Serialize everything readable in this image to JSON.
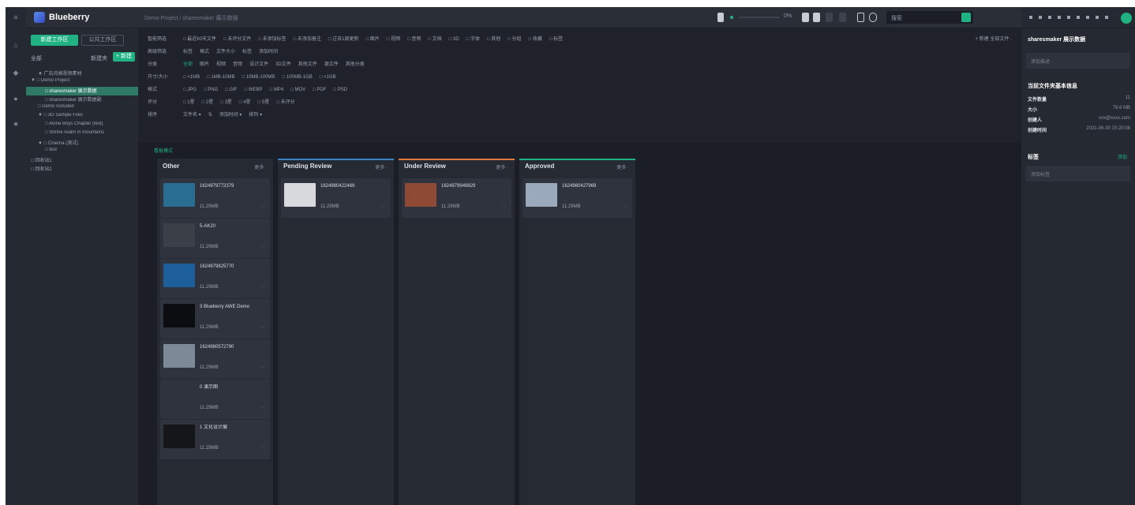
{
  "app": {
    "brand": "Blueberry",
    "breadcrumb": "Demo Project  /  sharesmaker 展示数据"
  },
  "rail": {
    "icons": [
      "menu-icon",
      "home-icon",
      "bell-icon",
      "user-icon",
      "star-icon"
    ]
  },
  "topbar": {
    "search_placeholder": "搜索",
    "zoom": "0%"
  },
  "sidebar": {
    "new_button": "新建工作区",
    "workspace_button": "公共工作区",
    "all_label": "全部",
    "add_folder": "新建夹",
    "new_tag": "+ 新建",
    "tree": [
      {
        "label": "▼ 广告风格视频素材",
        "indent": 1,
        "selected": false
      },
      {
        "label": "▼ □ Demo Project",
        "indent": 0,
        "selected": false
      },
      {
        "label": "□ sharesmaker 展示数据",
        "indent": 2,
        "selected": true
      },
      {
        "label": "□ sharesmaker 展示数据副",
        "indent": 2,
        "selected": false
      },
      {
        "label": "□ Demo Included",
        "indent": 1,
        "selected": false
      },
      {
        "label": "▼ □ 3D Sample Files",
        "indent": 1,
        "selected": false
      },
      {
        "label": "□ Alone Boys Chapter (test)",
        "indent": 2,
        "selected": false
      },
      {
        "label": "□ Shrine realm in mountains",
        "indent": 2,
        "selected": false
      },
      {
        "label": "▼ □ Cinema (测试)",
        "indent": 1,
        "selected": false
      },
      {
        "label": "□ test",
        "indent": 2,
        "selected": false
      },
      {
        "label": "□ 回收站1",
        "indent": 0,
        "selected": false
      },
      {
        "label": "□ 回收站2",
        "indent": 0,
        "selected": false
      }
    ]
  },
  "filters": {
    "right_label": "+ 新建  全部文件 ·",
    "rows": [
      {
        "label": "智能筛选",
        "chips": [
          "□ 最近60天文件",
          "□ 未评分文件",
          "□ 未添加标签",
          "□ 未添加备注",
          "□ 过去1周更新",
          "□ 图片",
          "□ 视频",
          "□ 音频",
          "□ 文档",
          "□ 3D",
          "□ 字体",
          "□ 其他",
          "□ 分组",
          "□ 收藏",
          "□ 标签"
        ]
      },
      {
        "label": "高级筛选",
        "chips": [
          "标签",
          "格式",
          "文件大小",
          "标签",
          "添加时间"
        ]
      },
      {
        "label": "分类",
        "chips": [
          "全部",
          "图片",
          "视频",
          "音频",
          "设计文件",
          "3D文件",
          "其他文件",
          "源文件",
          "其他分类"
        ]
      },
      {
        "label": "尺寸/大小",
        "chips": [
          "□ <1MB",
          "□ 1MB-10MB",
          "□ 10MB-100MB",
          "□ 100MB-1GB",
          "□ >1GB"
        ]
      },
      {
        "label": "格式",
        "chips": [
          "□ JPG",
          "□ PNG",
          "□ GIF",
          "□ WEBP",
          "□ MP4",
          "□ MOV",
          "□ PDF",
          "□ PSD"
        ]
      },
      {
        "label": "评分",
        "chips": [
          "□ 1星",
          "□ 2星",
          "□ 3星",
          "□ 4星",
          "□ 5星",
          "□ 未评分"
        ]
      },
      {
        "label": "排序",
        "chips": [
          "文件名 ▾",
          "⇅",
          "添加时间 ▾",
          "排列 ▾"
        ]
      }
    ]
  },
  "board": {
    "title": "看板模式",
    "columns": [
      {
        "name": "Other",
        "more": "更多 ·",
        "color": "#262a33",
        "cards": [
          {
            "title": "1624979772379",
            "size": "11.29MB",
            "thumb": "#2a6d92"
          },
          {
            "title": "5-AK20",
            "size": "11.29MB",
            "thumb": "#3a3f48"
          },
          {
            "title": "1624979825770",
            "size": "11.29MB",
            "thumb": "#1c5f9a"
          },
          {
            "title": "3 Blueberry AWE Demo",
            "size": "11.29MB",
            "thumb": "#0c0d10"
          },
          {
            "title": "1624980572790",
            "size": "11.29MB",
            "thumb": "#7c8a98"
          },
          {
            "title": "0 演示图",
            "size": "11.29MB",
            "thumb": "#2f333d"
          },
          {
            "title": "1 文化设计展",
            "size": "11.29MB",
            "thumb": "#15161a"
          }
        ]
      },
      {
        "name": "Pending Review",
        "more": "更多 ·",
        "color": "#3b82c4",
        "cards": [
          {
            "title": "1624980422469",
            "size": "11.29MB",
            "thumb": "#d7d9dc"
          }
        ]
      },
      {
        "name": "Under Review",
        "more": "更多 ·",
        "color": "#e07a3f",
        "cards": [
          {
            "title": "1624979949829",
            "size": "11.29MB",
            "thumb": "#8f4a35"
          }
        ]
      },
      {
        "name": "Approved",
        "more": "更多 ·",
        "color": "#20b283",
        "cards": [
          {
            "title": "1624980427969",
            "size": "11.29MB",
            "thumb": "#9aa9bc"
          }
        ]
      }
    ]
  },
  "right_panel": {
    "name": "sharesmaker 展示数据",
    "description_placeholder": "添加描述",
    "info_title": "当前文件夹基本信息",
    "info": [
      {
        "k": "文件数量",
        "v": "11"
      },
      {
        "k": "大小",
        "v": "78.6 MB"
      },
      {
        "k": "创建人",
        "v": "xxx@xxxx.com"
      },
      {
        "k": "创建时间",
        "v": "2021-06-30 15:20:08"
      }
    ],
    "tag_title": "标签",
    "tag_button": "添加",
    "tag_placeholder": "添加标签"
  }
}
